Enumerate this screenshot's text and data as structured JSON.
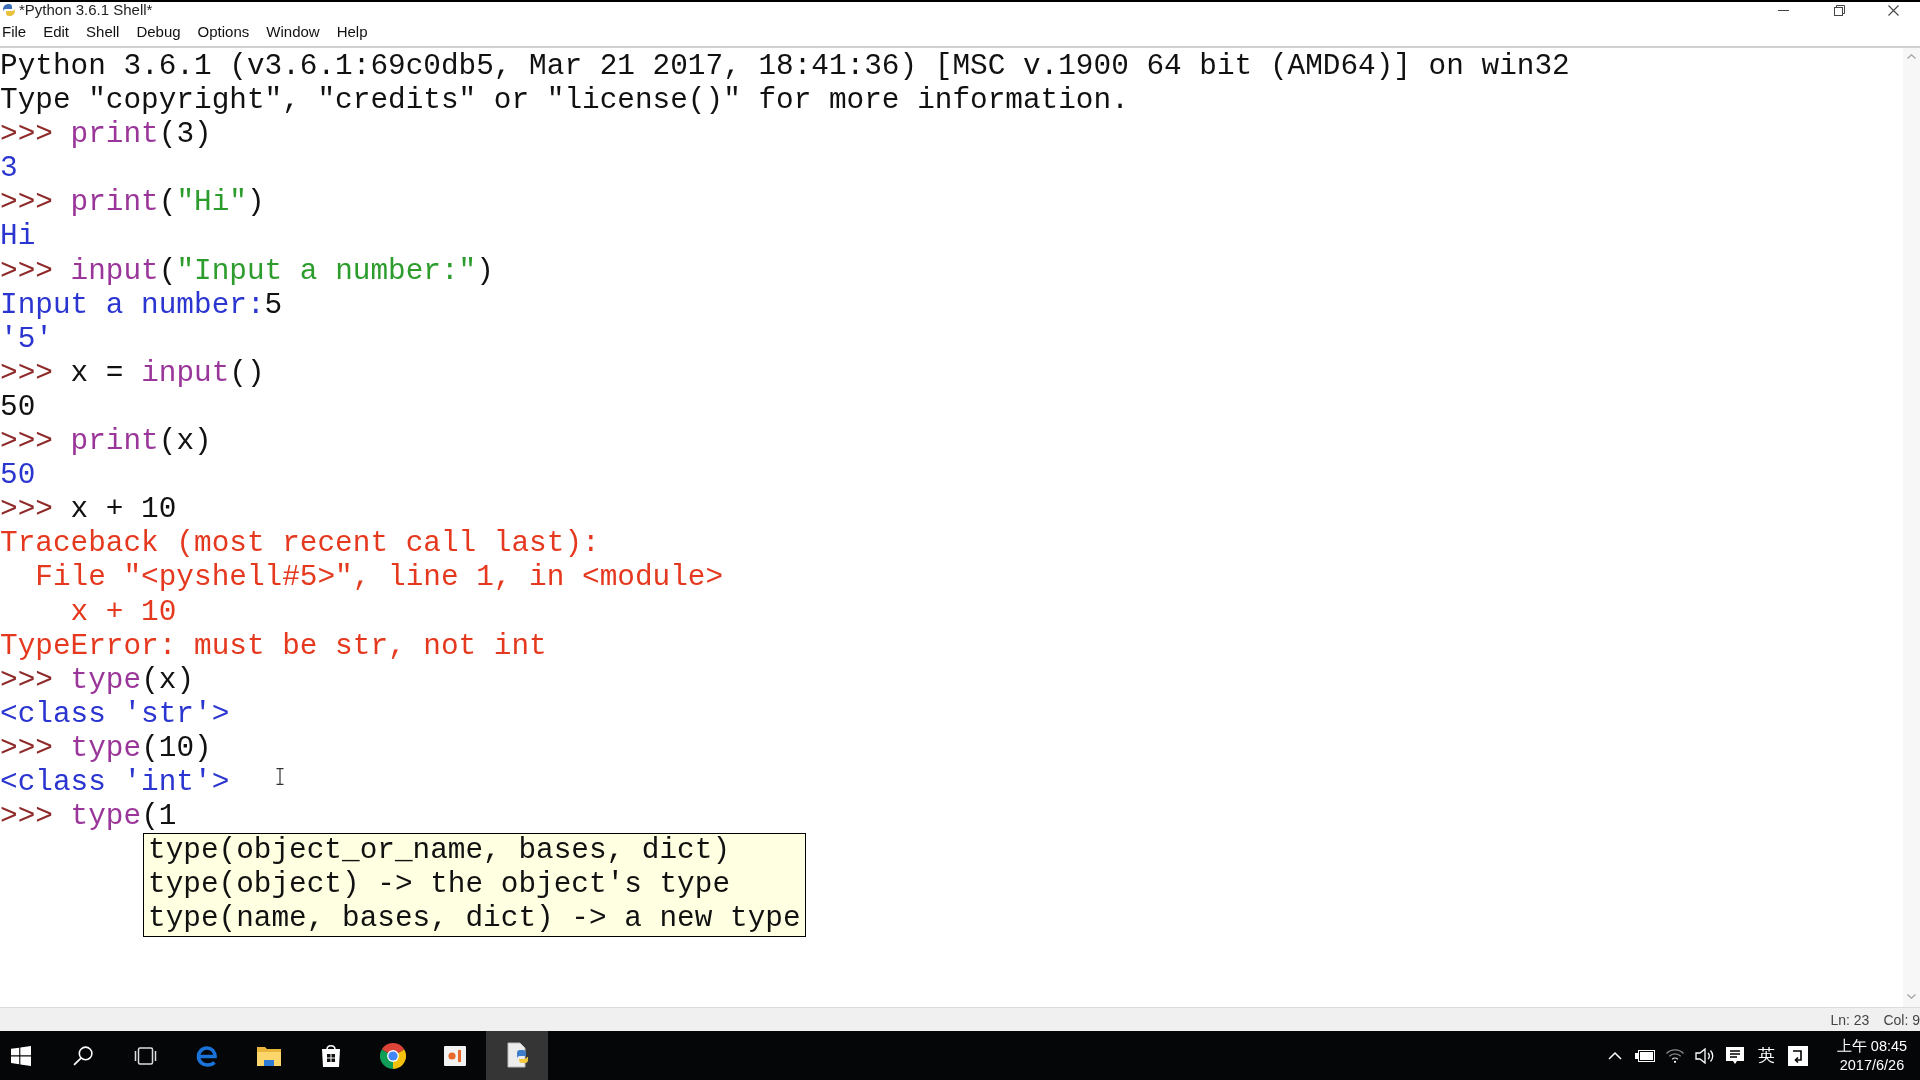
{
  "window": {
    "title": "*Python 3.6.1 Shell*"
  },
  "menu": [
    "File",
    "Edit",
    "Shell",
    "Debug",
    "Options",
    "Window",
    "Help"
  ],
  "shell_lines": [
    {
      "segments": [
        {
          "kind": "plain",
          "text": "Python 3.6.1 (v3.6.1:69c0db5, Mar 21 2017, 18:41:36) [MSC v.1900 64 bit (AMD64)] on win32"
        }
      ]
    },
    {
      "segments": [
        {
          "kind": "plain",
          "text": "Type \"copyright\", \"credits\" or \"license()\" for more information."
        }
      ]
    },
    {
      "segments": [
        {
          "kind": "prompt",
          "text": ">>> "
        },
        {
          "kind": "builtin",
          "text": "print"
        },
        {
          "kind": "plain",
          "text": "(3)"
        }
      ]
    },
    {
      "segments": [
        {
          "kind": "stdout",
          "text": "3"
        }
      ]
    },
    {
      "segments": [
        {
          "kind": "prompt",
          "text": ">>> "
        },
        {
          "kind": "builtin",
          "text": "print"
        },
        {
          "kind": "plain",
          "text": "("
        },
        {
          "kind": "string",
          "text": "\"Hi\""
        },
        {
          "kind": "plain",
          "text": ")"
        }
      ]
    },
    {
      "segments": [
        {
          "kind": "stdout",
          "text": "Hi"
        }
      ]
    },
    {
      "segments": [
        {
          "kind": "prompt",
          "text": ">>> "
        },
        {
          "kind": "builtin",
          "text": "input"
        },
        {
          "kind": "plain",
          "text": "("
        },
        {
          "kind": "string",
          "text": "\"Input a number:\""
        },
        {
          "kind": "plain",
          "text": ")"
        }
      ]
    },
    {
      "segments": [
        {
          "kind": "stdout",
          "text": "Input a number:"
        },
        {
          "kind": "stdin",
          "text": "5"
        }
      ]
    },
    {
      "segments": [
        {
          "kind": "stdout",
          "text": "'5'"
        }
      ]
    },
    {
      "segments": [
        {
          "kind": "prompt",
          "text": ">>> "
        },
        {
          "kind": "plain",
          "text": "x = "
        },
        {
          "kind": "builtin",
          "text": "input"
        },
        {
          "kind": "plain",
          "text": "()"
        }
      ]
    },
    {
      "segments": [
        {
          "kind": "stdin",
          "text": "50"
        }
      ]
    },
    {
      "segments": [
        {
          "kind": "prompt",
          "text": ">>> "
        },
        {
          "kind": "builtin",
          "text": "print"
        },
        {
          "kind": "plain",
          "text": "(x)"
        }
      ]
    },
    {
      "segments": [
        {
          "kind": "stdout",
          "text": "50"
        }
      ]
    },
    {
      "segments": [
        {
          "kind": "prompt",
          "text": ">>> "
        },
        {
          "kind": "plain",
          "text": "x + 10"
        }
      ]
    },
    {
      "segments": [
        {
          "kind": "stderr",
          "text": "Traceback (most recent call last):"
        }
      ]
    },
    {
      "segments": [
        {
          "kind": "stderr",
          "text": "  File \"<pyshell#5>\", line 1, in <module>"
        }
      ]
    },
    {
      "segments": [
        {
          "kind": "stderr",
          "text": "    x + 10"
        }
      ]
    },
    {
      "segments": [
        {
          "kind": "stderr",
          "text": "TypeError: must be str, not int"
        }
      ]
    },
    {
      "segments": [
        {
          "kind": "prompt",
          "text": ">>> "
        },
        {
          "kind": "builtin",
          "text": "type"
        },
        {
          "kind": "plain",
          "text": "(x)"
        }
      ]
    },
    {
      "segments": [
        {
          "kind": "stdout",
          "text": "<class 'str'>"
        }
      ]
    },
    {
      "segments": [
        {
          "kind": "prompt",
          "text": ">>> "
        },
        {
          "kind": "builtin",
          "text": "type"
        },
        {
          "kind": "plain",
          "text": "(10)"
        }
      ]
    },
    {
      "segments": [
        {
          "kind": "stdout",
          "text": "<class 'int'>"
        }
      ]
    },
    {
      "segments": [
        {
          "kind": "prompt",
          "text": ">>> "
        },
        {
          "kind": "builtin",
          "text": "type"
        },
        {
          "kind": "plain",
          "text": "(1"
        }
      ]
    }
  ],
  "calltip": {
    "lines": [
      "type(object_or_name, bases, dict)",
      "type(object) -> the object's type",
      "type(name, bases, dict) -> a new type"
    ]
  },
  "status_bar": {
    "line": "Ln: 23",
    "column": "Col: 9"
  },
  "taskbar": {
    "buttons": [
      {
        "kind": "start",
        "active": false
      },
      {
        "kind": "search",
        "active": false
      },
      {
        "kind": "task-view",
        "active": false
      },
      {
        "kind": "browser-e",
        "active": false
      },
      {
        "kind": "folder",
        "active": false
      },
      {
        "kind": "store",
        "active": false
      },
      {
        "kind": "browser-round",
        "active": false
      },
      {
        "kind": "slides",
        "active": false
      },
      {
        "kind": "python-file",
        "active": true
      }
    ],
    "input_language": "英",
    "clock": {
      "time": "上午 08:45",
      "date": "2017/6/26"
    }
  }
}
